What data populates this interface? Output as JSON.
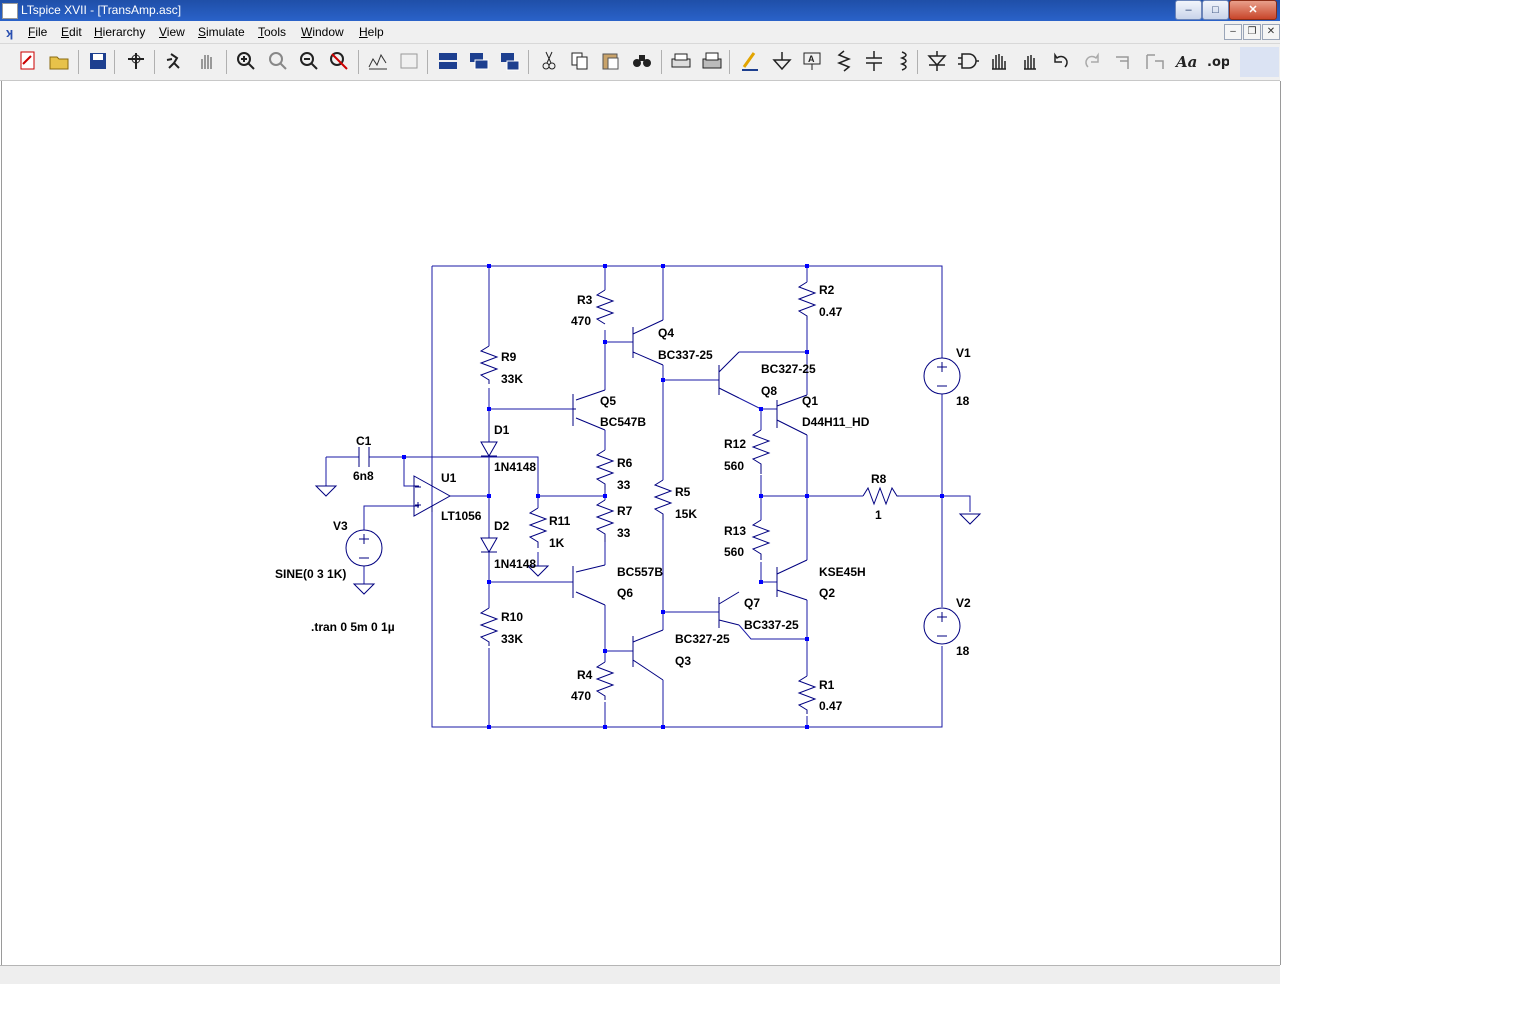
{
  "window": {
    "title": "LTspice XVII - [TransAmp.asc]"
  },
  "caption_buttons": {
    "minimize": "–",
    "maximize": "□",
    "close": "✕"
  },
  "mdi_buttons": {
    "minimize": "–",
    "restore": "❐",
    "close": "✕"
  },
  "menu": [
    "File",
    "Edit",
    "Hierarchy",
    "View",
    "Simulate",
    "Tools",
    "Window",
    "Help"
  ],
  "toolbar_icons": [
    "new-schematic-icon",
    "open-icon",
    "save-icon",
    "control-panel-icon",
    "run-icon",
    "halt-icon",
    "zoom-in-icon",
    "pan-icon",
    "zoom-out-icon",
    "zoom-fit-icon",
    "autorange-icon",
    "waveform-icon",
    "tile-horizontal-icon",
    "cascade-icon",
    "tile-vertical-icon",
    "cut-icon",
    "copy-icon",
    "paste-icon",
    "find-icon",
    "print-icon",
    "print-setup-icon",
    "draw-wire-icon",
    "ground-icon",
    "label-net-icon",
    "resistor-icon",
    "capacitor-icon",
    "inductor-icon",
    "diode-icon",
    "component-icon",
    "move-icon",
    "drag-icon",
    "undo-icon",
    "redo-icon",
    "rotate-icon",
    "mirror-icon",
    "text-icon",
    "spice-directive-icon"
  ],
  "schematic": {
    "labels": {
      "C1": "C1",
      "C1_val": "6n8",
      "U1": "U1",
      "U1_val": "LT1056",
      "V3": "V3",
      "V3_val": "SINE(0 3 1K)",
      "directive": ".tran 0 5m 0 1µ",
      "R9": "R9",
      "R9_val": "33K",
      "D1": "D1",
      "D1_val": "1N4148",
      "D2": "D2",
      "D2_val": "1N4148",
      "R10": "R10",
      "R10_val": "33K",
      "R11": "R11",
      "R11_val": "1K",
      "R3": "R3",
      "R3_val": "470",
      "R4": "R4",
      "R4_val": "470",
      "Q4": "Q4",
      "Q4_val": "BC337-25",
      "Q5": "Q5",
      "Q5_val": "BC547B",
      "R6": "R6",
      "R6_val": "33",
      "R7": "R7",
      "R7_val": "33",
      "Q6": "Q6",
      "Q6_val": "BC557B",
      "Q3": "Q3",
      "Q3_val": "BC327-25",
      "R5": "R5",
      "R5_val": "15K",
      "Q8": "Q8",
      "Q8_val": "BC327-25",
      "Q7": "Q7",
      "Q7_val": "BC337-25",
      "R12": "R12",
      "R12_val": "560",
      "R13": "R13",
      "R13_val": "560",
      "Q1": "Q1",
      "Q1_val": "D44H11_HD",
      "Q2": "Q2",
      "Q2_val": "KSE45H",
      "R2": "R2",
      "R2_val": "0.47",
      "R1": "R1",
      "R1_val": "0.47",
      "R8": "R8",
      "R8_val": "1",
      "V1": "V1",
      "V1_val": "18",
      "V2": "V2",
      "V2_val": "18"
    }
  },
  "colors": {
    "wire": "#1a1aa6",
    "junction": "#0000ff",
    "component": "#000080",
    "title_bar": "#2a5bc3"
  }
}
